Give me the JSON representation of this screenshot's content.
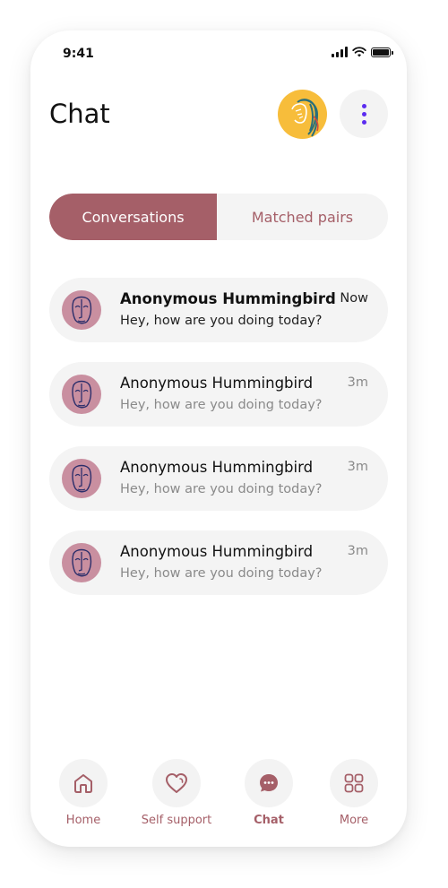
{
  "status_bar": {
    "time": "9:41"
  },
  "header": {
    "title": "Chat"
  },
  "tabs": [
    {
      "label": "Conversations",
      "active": true
    },
    {
      "label": "Matched pairs",
      "active": false
    }
  ],
  "conversations": [
    {
      "name": "Anonymous Hummingbird",
      "preview": "Hey, how are you doing today?",
      "time": "Now",
      "unread": true
    },
    {
      "name": "Anonymous Hummingbird",
      "preview": "Hey, how are you doing today?",
      "time": "3m",
      "unread": false
    },
    {
      "name": "Anonymous Hummingbird",
      "preview": "Hey, how are you doing today?",
      "time": "3m",
      "unread": false
    },
    {
      "name": "Anonymous Hummingbird",
      "preview": "Hey, how are you doing today?",
      "time": "3m",
      "unread": false
    }
  ],
  "bottom_nav": [
    {
      "label": "Home",
      "icon": "home-icon",
      "active": false
    },
    {
      "label": "Self support",
      "icon": "heart-icon",
      "active": false
    },
    {
      "label": "Chat",
      "icon": "chat-bubble-icon",
      "active": true
    },
    {
      "label": "More",
      "icon": "grid-icon",
      "active": false
    }
  ],
  "colors": {
    "accent": "#a55f68",
    "menu_dots": "#5b2cf0",
    "avatar_bg": "#f7bd3b",
    "conversation_avatar_bg": "#c98fa0",
    "pill_bg": "#f4f4f4"
  }
}
